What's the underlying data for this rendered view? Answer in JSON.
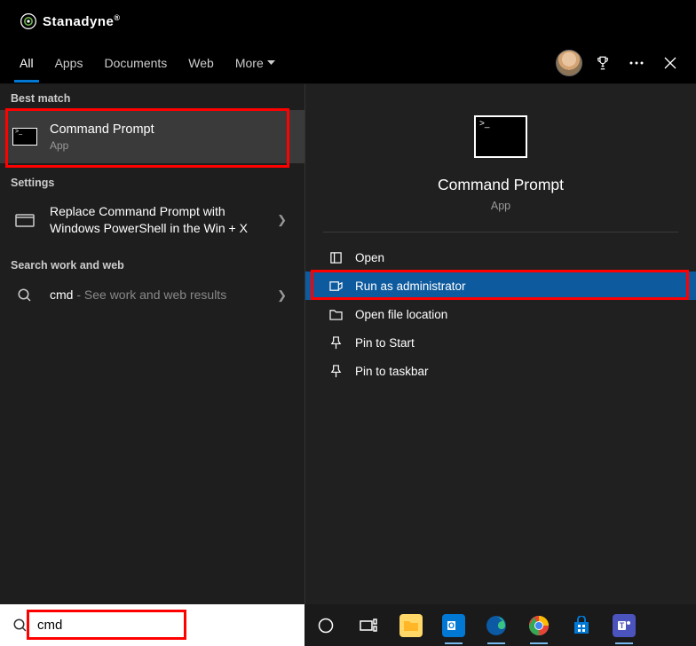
{
  "brand": {
    "name": "Stanadyne"
  },
  "tabs": {
    "items": [
      {
        "label": "All",
        "active": true
      },
      {
        "label": "Apps",
        "active": false
      },
      {
        "label": "Documents",
        "active": false
      },
      {
        "label": "Web",
        "active": false
      },
      {
        "label": "More",
        "active": false,
        "dropdown": true
      }
    ]
  },
  "left": {
    "best_match_label": "Best match",
    "best_match": {
      "title": "Command Prompt",
      "subtitle": "App"
    },
    "settings_label": "Settings",
    "settings_item": {
      "title": "Replace Command Prompt with Windows PowerShell in the Win + X"
    },
    "web_label": "Search work and web",
    "web_item": {
      "prefix": "cmd",
      "suffix": " - See work and web results"
    }
  },
  "detail": {
    "title": "Command Prompt",
    "subtitle": "App",
    "actions": [
      {
        "label": "Open",
        "icon": "open",
        "selected": false
      },
      {
        "label": "Run as administrator",
        "icon": "shield",
        "selected": true
      },
      {
        "label": "Open file location",
        "icon": "folder",
        "selected": false
      },
      {
        "label": "Pin to Start",
        "icon": "pin",
        "selected": false
      },
      {
        "label": "Pin to taskbar",
        "icon": "pin",
        "selected": false
      }
    ]
  },
  "search": {
    "value": "cmd"
  },
  "highlights": {
    "best_match": true,
    "run_as_admin": true,
    "search_box": true
  },
  "colors": {
    "accent": "#0078d4",
    "highlight": "#f00",
    "selected_action": "#0d5a9e"
  }
}
